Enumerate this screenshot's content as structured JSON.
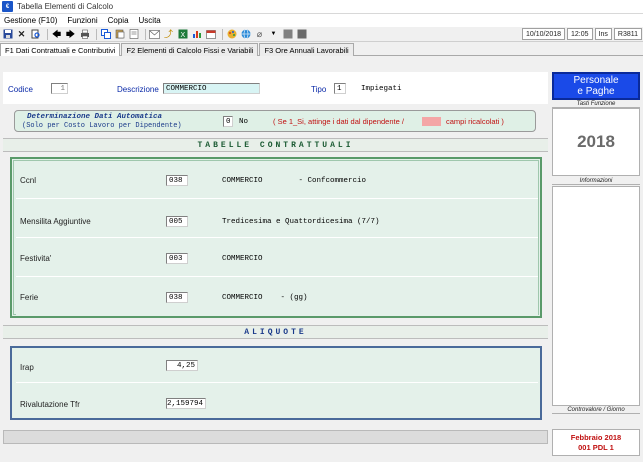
{
  "window": {
    "title": "Tabella Elementi di Calcolo",
    "icon_text": "€"
  },
  "menu": [
    "Gestione (F10)",
    "Funzioni",
    "Copia",
    "Uscita"
  ],
  "status": {
    "date": "10/10/2018",
    "time": "12:05",
    "mode": "Ins",
    "code": "R3811"
  },
  "tabs": [
    "F1 Dati Contrattuali e Contributivi",
    "F2 Elementi di Calcolo Fissi e Variabili",
    "F3 Ore Annuali Lavorabili"
  ],
  "header": {
    "codice_label": "Codice",
    "codice_value": "1",
    "descrizione_label": "Descrizione",
    "descrizione_value": "COMMERCIO",
    "tipo_label": "Tipo",
    "tipo_value": "1",
    "tipo_text": "Impiegati"
  },
  "auto": {
    "title": "Determinazione Dati Automatica",
    "subtitle": "(Solo per Costo Lavoro per Dipendente)",
    "value": "0",
    "value_text": "No",
    "note_left": "( Se 1_Si, attinge i dati dal dipendente /",
    "note_right": "campi ricalcolati )",
    "note_color": "#f4a6a6"
  },
  "tabelle": {
    "title": "TABELLE CONTRATTUALI",
    "rows": [
      {
        "label": "Ccnl",
        "code": "038",
        "text": "COMMERCIO        - Confcommercio"
      },
      {
        "label": "Mensilita Aggiuntive",
        "code": "005",
        "text": "Tredicesima e Quattordicesima (7/7)"
      },
      {
        "label": "Festivita'",
        "code": "003",
        "text": "COMMERCIO"
      },
      {
        "label": "Ferie",
        "code": "038",
        "text": "COMMERCIO    - (gg)"
      }
    ]
  },
  "aliquote": {
    "title": "ALIQUOTE",
    "rows": [
      {
        "label": "Irap",
        "value": "4,25"
      },
      {
        "label": "Rivalutazione Tfr",
        "value": "2,159794"
      }
    ]
  },
  "right": {
    "brand_line1": "Personale",
    "brand_line2": "e Paghe",
    "tasti_label": "Tasti Funzione",
    "year": "2018",
    "info_label": "Informazioni",
    "controvalore_label": "Controvalore / Giorno",
    "period": "Febbraio 2018",
    "pdl": "001 PDL 1"
  },
  "colors": {
    "brand": "#1a4ae8",
    "section": "#1a5a32",
    "period": "#c01010"
  }
}
